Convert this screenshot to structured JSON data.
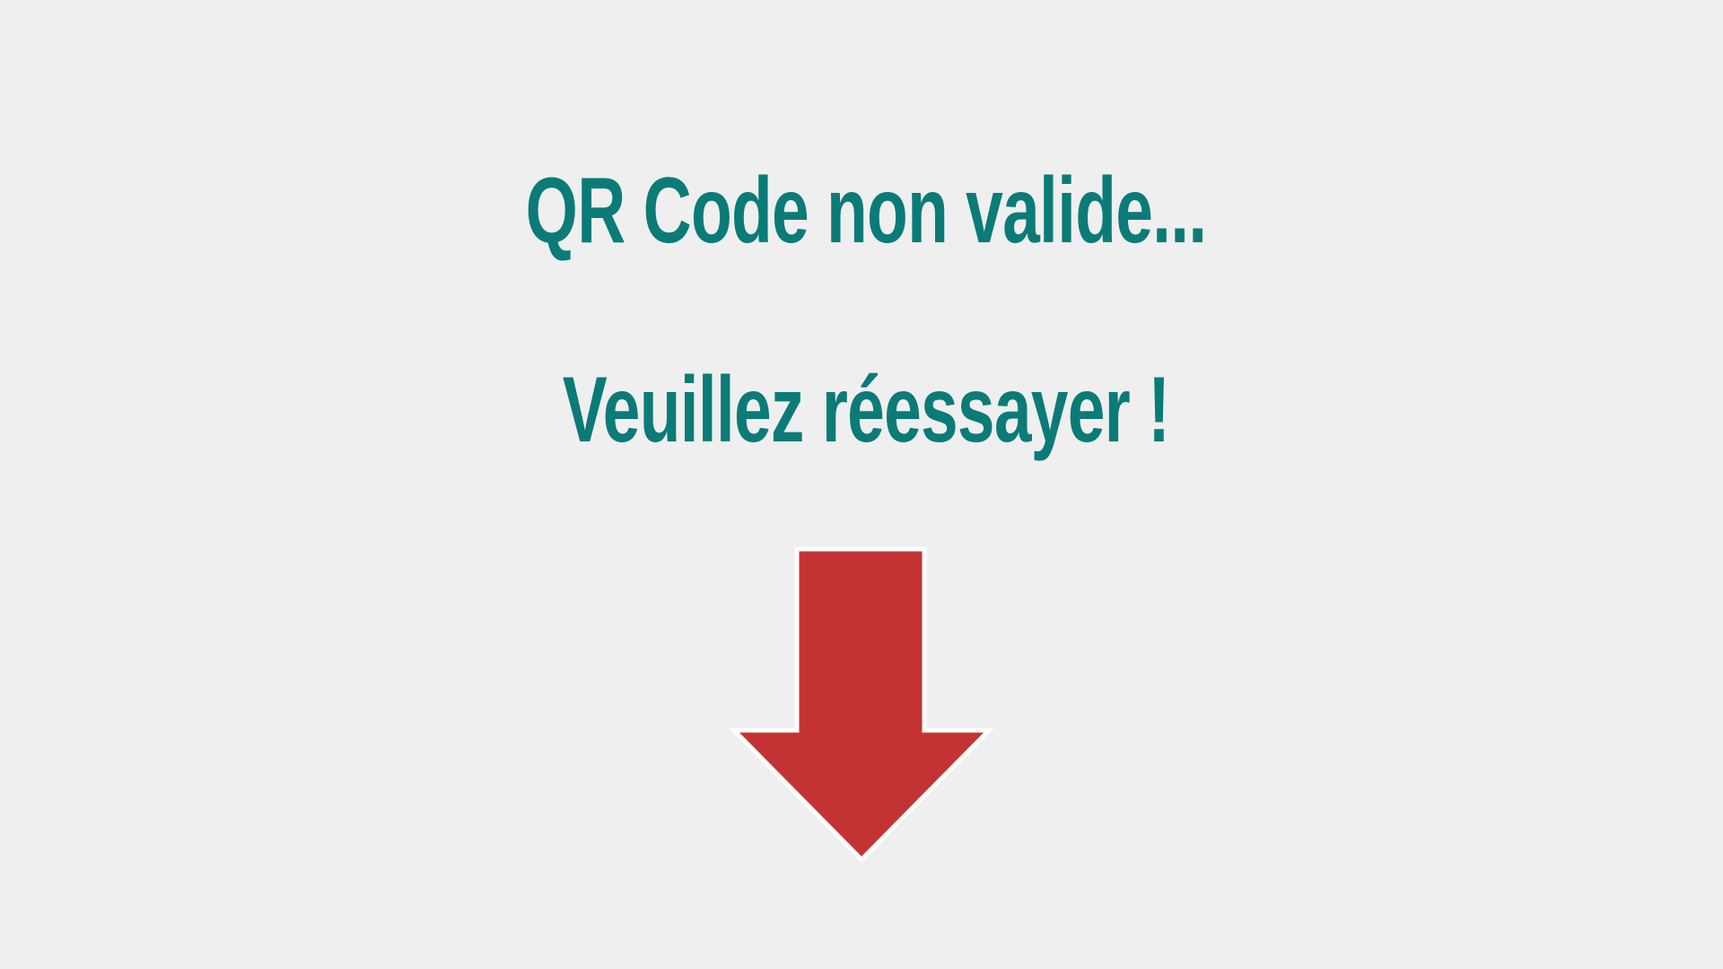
{
  "screen": {
    "title_line_1": "QR Code non valide...",
    "title_line_2": "Veuillez réessayer !"
  },
  "icons": {
    "arrow": "arrow-down-icon"
  },
  "colors": {
    "background": "#efefef",
    "text": "#0b7b77",
    "arrow": "#c43333",
    "arrow_outline": "#ffffff"
  }
}
